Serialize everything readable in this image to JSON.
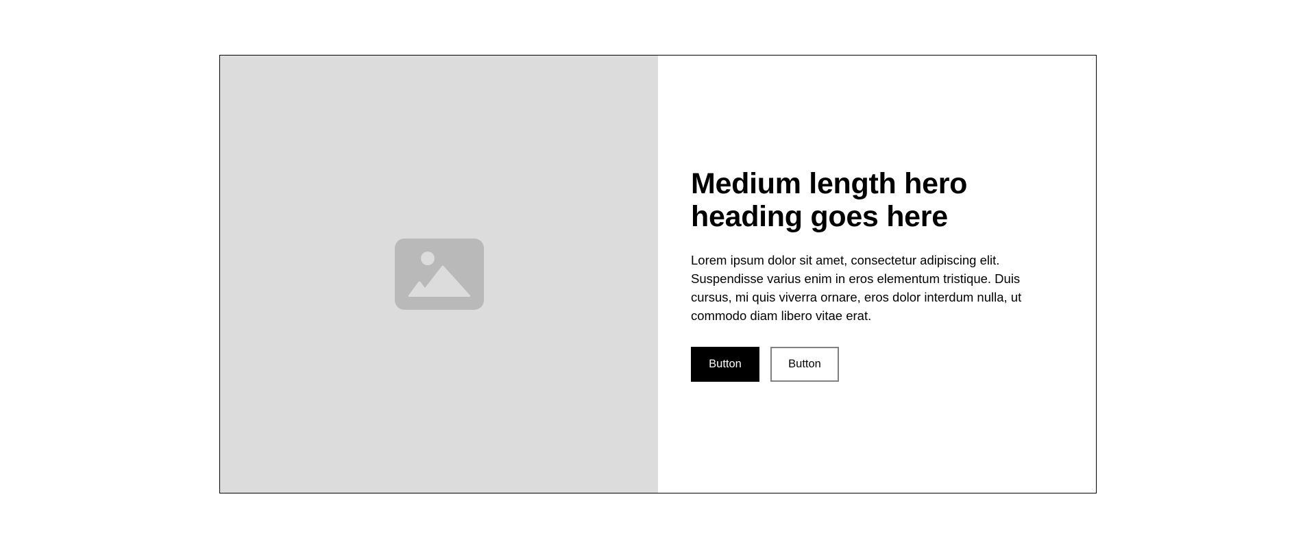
{
  "hero": {
    "image_placeholder": {
      "icon": "image-placeholder-icon",
      "background_color": "#dcdcdc",
      "icon_color": "#b9b9b9",
      "icon_detail_color": "#dcdcdc"
    },
    "heading": "Medium length hero heading goes here",
    "body": "Lorem ipsum dolor sit amet, consectetur adipiscing elit. Suspendisse varius enim in eros elementum tristique. Duis cursus, mi quis viverra ornare, eros dolor interdum nulla, ut commodo diam libero vitae erat.",
    "primary_button_label": "Button",
    "secondary_button_label": "Button",
    "colors": {
      "primary_button_bg": "#000000",
      "primary_button_text": "#ffffff",
      "secondary_button_border": "#808080",
      "border": "#000000"
    }
  }
}
